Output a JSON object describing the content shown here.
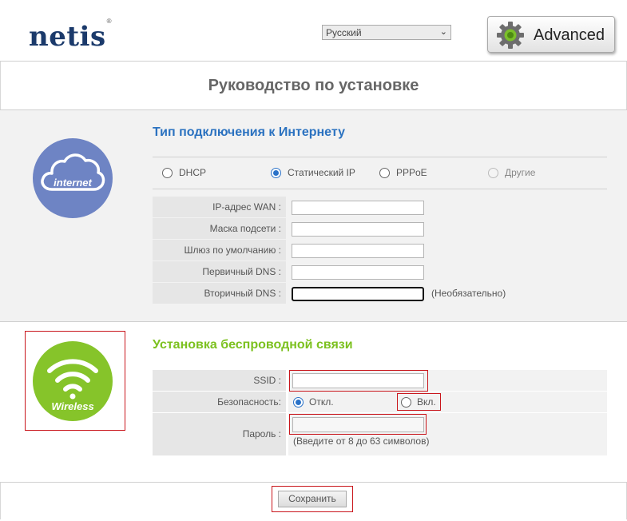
{
  "header": {
    "brand": "netis",
    "trademark": "®",
    "language_selected": "Русский",
    "advanced_label": "Advanced"
  },
  "page_title": "Руководство по установке",
  "internet": {
    "icon_label": "internet",
    "heading": "Тип подключения к Интернету",
    "connection_types": [
      {
        "label": "DHCP",
        "selected": false,
        "enabled": true
      },
      {
        "label": "Статический IP",
        "selected": true,
        "enabled": true
      },
      {
        "label": "PPPoE",
        "selected": false,
        "enabled": true
      },
      {
        "label": "Другие",
        "selected": false,
        "enabled": false
      }
    ],
    "fields": [
      {
        "label": "IP-адрес WAN :",
        "value": ""
      },
      {
        "label": "Маска подсети :",
        "value": ""
      },
      {
        "label": "Шлюз по умолчанию :",
        "value": ""
      },
      {
        "label": "Первичный DNS :",
        "value": ""
      },
      {
        "label": "Вторичный DNS :",
        "value": "",
        "note": "(Необязательно)"
      }
    ]
  },
  "wireless": {
    "icon_label": "Wireless",
    "heading": "Установка беспроводной связи",
    "ssid_label": "SSID :",
    "ssid_value": "",
    "security_label": "Безопасность:",
    "security_off": "Откл.",
    "security_on": "Вкл.",
    "security_selected": "off",
    "password_label": "Пароль :",
    "password_value": "",
    "password_hint": "(Введите от 8 до 63 символов)"
  },
  "save_label": "Сохранить",
  "colors": {
    "brand": "#1b3a6b",
    "internet_heading": "#2b72c0",
    "wireless_heading": "#7cc11f",
    "internet_icon": "#6e84c4",
    "wireless_icon": "#86c42a",
    "highlight": "#c9161c"
  },
  "icons": [
    "gear-icon",
    "cloud-icon",
    "wifi-icon",
    "chevron-down-icon"
  ]
}
